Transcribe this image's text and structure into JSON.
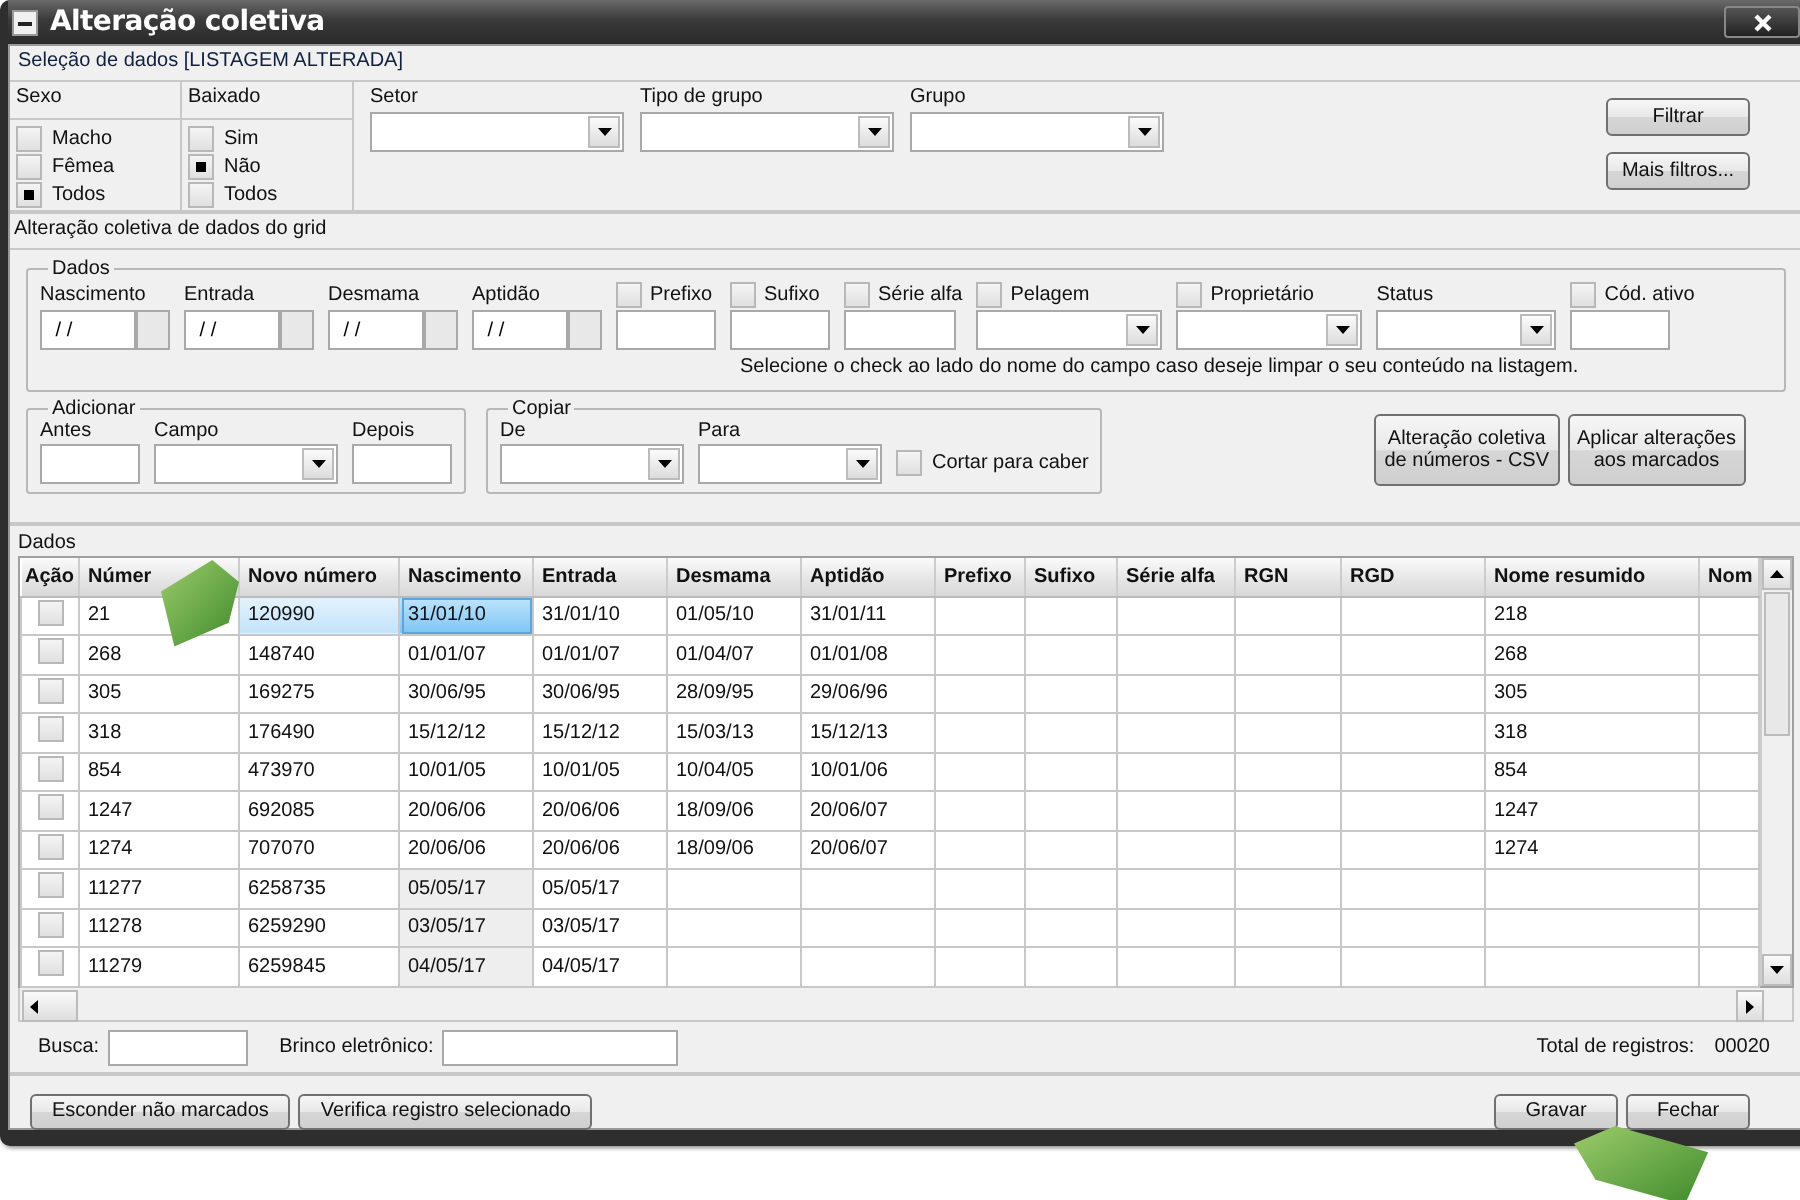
{
  "window": {
    "title": "Alteração coletiva"
  },
  "selection": {
    "title": "Seleção de dados [LISTAGEM ALTERADA]",
    "groups": [
      {
        "label": "Sexo",
        "options": [
          {
            "label": "Macho",
            "checked": false
          },
          {
            "label": "Fêmea",
            "checked": false
          },
          {
            "label": "Todos",
            "checked": true
          }
        ]
      },
      {
        "label": "Baixado",
        "options": [
          {
            "label": "Sim",
            "checked": false
          },
          {
            "label": "Não",
            "checked": true
          },
          {
            "label": "Todos",
            "checked": false
          }
        ]
      }
    ],
    "dropdowns": [
      {
        "label": "Setor"
      },
      {
        "label": "Tipo de grupo"
      },
      {
        "label": "Grupo"
      }
    ],
    "buttons": [
      {
        "label": "Filtrar"
      },
      {
        "label": "Mais filtros..."
      }
    ]
  },
  "edit": {
    "title": "Alteração coletiva de dados do grid",
    "dados": {
      "legend": "Dados",
      "fields": [
        {
          "kind": "date",
          "label": "Nascimento",
          "value": " / /"
        },
        {
          "kind": "date",
          "label": "Entrada",
          "value": " / /"
        },
        {
          "kind": "date",
          "label": "Desmama",
          "value": " / /"
        },
        {
          "kind": "date",
          "label": "Aptidão",
          "value": " / /"
        },
        {
          "kind": "check-text",
          "label": "Prefixo",
          "checked": false
        },
        {
          "kind": "check-text",
          "label": "Sufixo",
          "checked": false
        },
        {
          "kind": "check-text",
          "label": "Série alfa",
          "checked": false
        },
        {
          "kind": "check-select",
          "label": "Pelagem",
          "checked": false
        },
        {
          "kind": "check-select",
          "label": "Proprietário",
          "checked": false
        },
        {
          "kind": "select",
          "label": "Status"
        },
        {
          "kind": "check-text",
          "label": "Cód. ativo",
          "checked": false
        }
      ],
      "hint": "Selecione o check ao lado do nome do campo caso deseje limpar o seu conteúdo na listagem."
    },
    "adicionar": {
      "legend": "Adicionar",
      "fields": [
        {
          "kind": "text",
          "label": "Antes"
        },
        {
          "kind": "select",
          "label": "Campo"
        },
        {
          "kind": "text",
          "label": "Depois"
        }
      ]
    },
    "copiar": {
      "legend": "Copiar",
      "fields": [
        {
          "kind": "select",
          "label": "De"
        },
        {
          "kind": "select",
          "label": "Para"
        }
      ],
      "option": {
        "label": "Cortar para caber",
        "checked": false
      }
    },
    "buttons": [
      {
        "lines": [
          "Alteração coletiva",
          "de números - CSV"
        ]
      },
      {
        "lines": [
          "Aplicar alterações",
          "aos marcados"
        ]
      }
    ]
  },
  "grid": {
    "title": "Dados",
    "action_column": "Ação",
    "columns": [
      "Númer",
      "Novo número",
      "Nascimento",
      "Entrada",
      "Desmama",
      "Aptidão",
      "Prefixo",
      "Sufixo",
      "Série alfa",
      "RGN",
      "RGD",
      "Nome resumido",
      "Nom"
    ],
    "rows": [
      {
        "checked": false,
        "selected": true,
        "birth_shaded": false,
        "cells": [
          "21",
          "120990",
          "31/01/10",
          "31/01/10",
          "01/05/10",
          "31/01/11",
          null,
          null,
          null,
          null,
          null,
          "218"
        ]
      },
      {
        "checked": false,
        "selected": false,
        "birth_shaded": false,
        "cells": [
          "268",
          "148740",
          "01/01/07",
          "01/01/07",
          "01/04/07",
          "01/01/08",
          null,
          null,
          null,
          null,
          null,
          "268"
        ]
      },
      {
        "checked": false,
        "selected": false,
        "birth_shaded": false,
        "cells": [
          "305",
          "169275",
          "30/06/95",
          "30/06/95",
          "28/09/95",
          "29/06/96",
          null,
          null,
          null,
          null,
          null,
          "305"
        ]
      },
      {
        "checked": false,
        "selected": false,
        "birth_shaded": false,
        "cells": [
          "318",
          "176490",
          "15/12/12",
          "15/12/12",
          "15/03/13",
          "15/12/13",
          null,
          null,
          null,
          null,
          null,
          "318"
        ]
      },
      {
        "checked": false,
        "selected": false,
        "birth_shaded": false,
        "cells": [
          "854",
          "473970",
          "10/01/05",
          "10/01/05",
          "10/04/05",
          "10/01/06",
          null,
          null,
          null,
          null,
          null,
          "854"
        ]
      },
      {
        "checked": false,
        "selected": false,
        "birth_shaded": false,
        "cells": [
          "1247",
          "692085",
          "20/06/06",
          "20/06/06",
          "18/09/06",
          "20/06/07",
          null,
          null,
          null,
          null,
          null,
          "1247"
        ]
      },
      {
        "checked": false,
        "selected": false,
        "birth_shaded": false,
        "cells": [
          "1274",
          "707070",
          "20/06/06",
          "20/06/06",
          "18/09/06",
          "20/06/07",
          null,
          null,
          null,
          null,
          null,
          "1274"
        ]
      },
      {
        "checked": false,
        "selected": false,
        "birth_shaded": true,
        "cells": [
          "11277",
          "6258735",
          "05/05/17",
          "05/05/17"
        ]
      },
      {
        "checked": false,
        "selected": false,
        "birth_shaded": true,
        "cells": [
          "11278",
          "6259290",
          "03/05/17",
          "03/05/17"
        ]
      },
      {
        "checked": false,
        "selected": false,
        "birth_shaded": true,
        "cells": [
          "11279",
          "6259845",
          "04/05/17",
          "04/05/17"
        ]
      }
    ]
  },
  "search": {
    "fields": [
      {
        "label": "Busca:"
      },
      {
        "label": "Brinco eletrônico:"
      }
    ],
    "total_label": "Total de registros:",
    "total": "00020"
  },
  "footer": {
    "left_buttons": [
      {
        "label": "Esconder não marcados"
      },
      {
        "label": "Verifica registro selecionado"
      }
    ],
    "right_buttons": [
      {
        "label": "Gravar"
      },
      {
        "label": "Fechar"
      }
    ]
  }
}
